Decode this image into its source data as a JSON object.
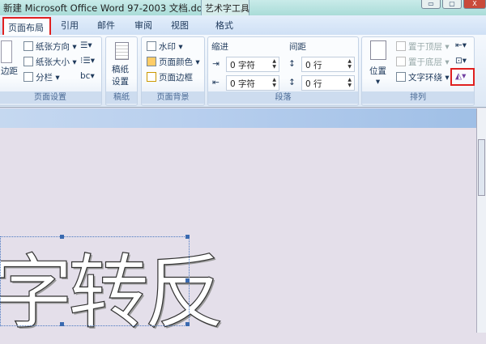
{
  "window": {
    "title": "新建 Microsoft Office Word 97-2003 文档.do...",
    "context_tab": "艺术字工具",
    "min": "▭",
    "max": "▢",
    "close": "X"
  },
  "tabs": [
    {
      "label": "页面布局"
    },
    {
      "label": "引用"
    },
    {
      "label": "邮件"
    },
    {
      "label": "审阅"
    },
    {
      "label": "视图"
    },
    {
      "label": "格式"
    }
  ],
  "ribbon": {
    "page_setup": {
      "label": "页面设置",
      "margins": "边距",
      "orientation": "纸张方向",
      "size": "纸张大小",
      "columns": "分栏"
    },
    "manuscript": {
      "label": "稿纸",
      "button": "稿纸\n设置",
      "b1": "稿纸",
      "b2": "设置"
    },
    "background": {
      "label": "页面背景",
      "watermark": "水印",
      "page_color": "页面颜色",
      "page_border": "页面边框"
    },
    "paragraph": {
      "label": "段落",
      "indent": "缩进",
      "spacing": "间距",
      "indent_left": "0 字符",
      "indent_right": "0 字符",
      "spacing_before": "0 行",
      "spacing_after": "0 行"
    },
    "arrange": {
      "label": "排列",
      "position": "位置",
      "bring_front": "置于顶层",
      "send_back": "置于底层",
      "text_wrap": "文字环绕"
    }
  },
  "document": {
    "wordart_text": "字转反"
  }
}
